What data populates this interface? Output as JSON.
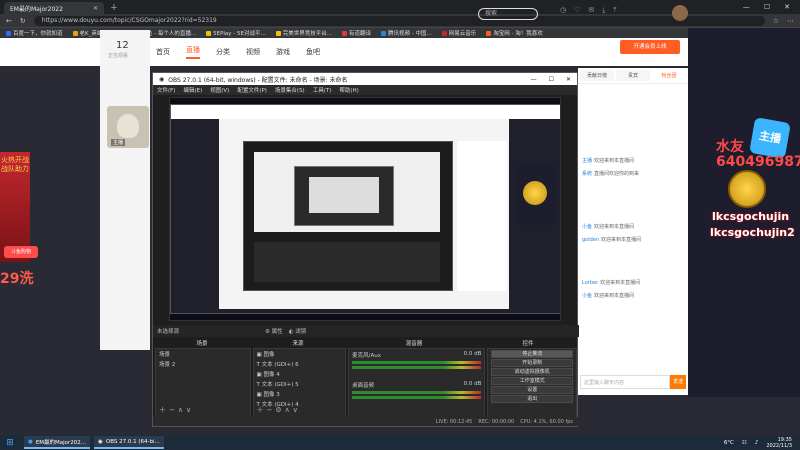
{
  "browser": {
    "tab_title": "EM最的Major2022",
    "url": "https://www.douyu.com/topic/CSGOmajor2022?rid=52319",
    "bookmarks": [
      "百度一下，你就知道",
      "老K_英雄手游大全",
      "斗鱼 - 每个人的直播...",
      "5EPlay - 5E对战平...",
      "完美世界竞技平台...",
      "有道翻译",
      "腾讯视频 - 中国...",
      "网易云音乐",
      "淘宝网 - 淘！我喜欢"
    ]
  },
  "site": {
    "logo": "斗鱼",
    "nav": [
      "首页",
      "直播",
      "分类",
      "视频",
      "游戏",
      "鱼吧"
    ],
    "active_nav": "直播",
    "search_placeholder": "搜索",
    "room_count": "12",
    "room_count_sub": "正在观看",
    "streamer_tag": "主播",
    "top_button": "开通会员上线",
    "chat_tabs": [
      "贡献日榜",
      "贵宾",
      "粉丝团"
    ],
    "chat_messages": [
      {
        "user": "主播",
        "text": "欢迎来到本直播间"
      },
      {
        "user": "系统",
        "text": "直播间欢迎你的到来"
      },
      {
        "user": "小鱼",
        "text": "欢迎来到本直播间"
      },
      {
        "user": "golden",
        "text": "欢迎来到本直播间"
      },
      {
        "user": "Lorber",
        "text": "欢迎来到本直播间"
      },
      {
        "user": "小鱼",
        "text": "欢迎来到本直播间"
      }
    ],
    "chat_input_placeholder": "这里输入聊天内容",
    "send": "发送"
  },
  "left_banner": {
    "text": "火热开战 战队助力",
    "number": "29洗",
    "promo": "斗鱼购物"
  },
  "overlay": {
    "viewer_label": "水友",
    "viewer_id": "640496987",
    "name_1": "lkcsgochujin",
    "name_2": "lkcsgochujin2",
    "badge": "主播"
  },
  "obs": {
    "title": "OBS 27.0.1 (64-bit, windows) - 配置文件: 未命名 - 场景: 未命名",
    "menu": [
      "文件(F)",
      "编辑(E)",
      "视图(V)",
      "配置文件(P)",
      "场景集合(S)",
      "工具(T)",
      "帮助(H)"
    ],
    "status_label": "未选择源",
    "status_buttons": [
      "属性",
      "滤镜"
    ],
    "dock_headers": [
      "场景",
      "来源",
      "混音器",
      "转场特效",
      "控件"
    ],
    "scenes": [
      "场景",
      "场景 2"
    ],
    "sources": [
      "图像",
      "文本 (GDI+) 6",
      "图像 4",
      "文本 (GDI+) 5",
      "图像 3",
      "文本 (GDI+) 4",
      "图像 2"
    ],
    "mixer": [
      {
        "name": "麦克风/Aux",
        "level": "0.0 dB"
      },
      {
        "name": "桌面音频",
        "level": "0.0 dB"
      }
    ],
    "controls": [
      "停止推流",
      "开始录制",
      "启动虚拟摄像机",
      "工作室模式",
      "设置",
      "退出"
    ],
    "active_control": "停止推流",
    "statusbar": [
      "LIVE: 00:12:45",
      "REC: 00:00:00",
      "CPU: 4.1%, 60.00 fps"
    ]
  },
  "taskbar": {
    "apps": [
      "EM最的Major202...",
      "OBS 27.0.1 (64-bi..."
    ],
    "weather": "6°C",
    "time": "19:35",
    "date": "2022/11/3"
  }
}
